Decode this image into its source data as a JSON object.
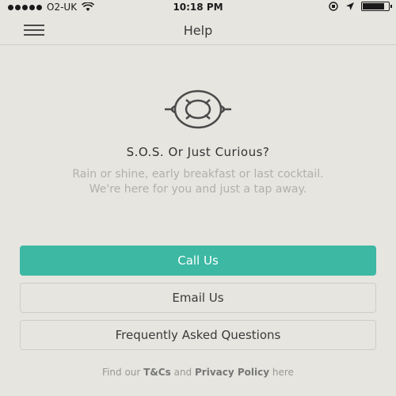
{
  "status_bar": {
    "carrier": "O2-UK",
    "time": "10:18 PM",
    "battery_level": 0.85
  },
  "nav": {
    "title": "Help",
    "menu_icon": "hamburger-icon"
  },
  "content": {
    "icon": "lifebuoy-icon",
    "headline": "S.O.S. Or Just Curious?",
    "subtext_line1": "Rain or shine, early breakfast or last cocktail.",
    "subtext_line2": "We're here for you and just a tap away."
  },
  "buttons": {
    "call": "Call Us",
    "email": "Email Us",
    "faq": "Frequently Asked Questions"
  },
  "footer": {
    "prefix": "Find our",
    "tcs": "T&Cs",
    "and": "and",
    "privacy": "Privacy Policy",
    "suffix": "here"
  },
  "colors": {
    "accent": "#3cb8a3",
    "background": "#e6e5e0"
  }
}
